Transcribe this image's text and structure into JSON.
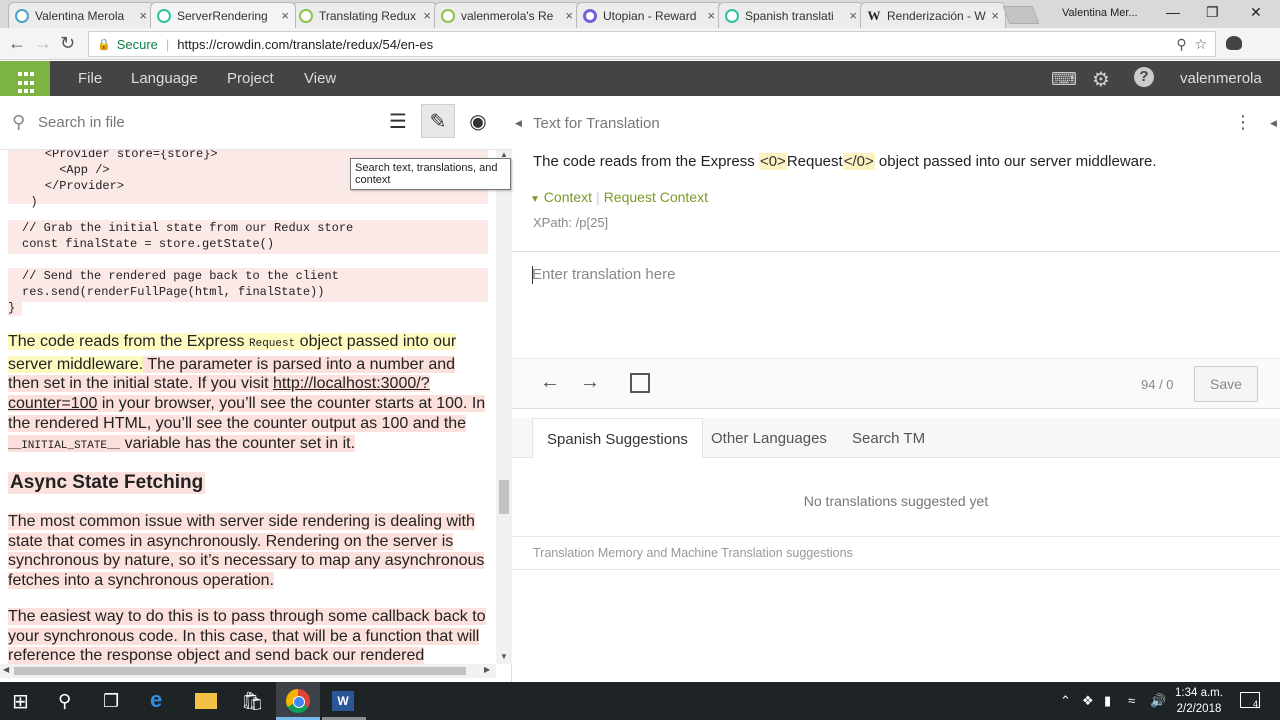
{
  "browser": {
    "tabs": [
      {
        "label": "Valentina Merola",
        "favicon": "steemit-icon"
      },
      {
        "label": "ServerRendering",
        "favicon": "crowdin-icon",
        "active": true
      },
      {
        "label": "Translating Redux",
        "favicon": "crowdin-icon"
      },
      {
        "label": "valenmerola's Re",
        "favicon": "crowdin-icon"
      },
      {
        "label": "Utopian - Reward",
        "favicon": "utopian-icon"
      },
      {
        "label": "Spanish translati",
        "favicon": "crowdin-icon"
      },
      {
        "label": "Renderización - W",
        "favicon": "wikipedia-icon"
      }
    ],
    "tab_close_glyph": "×",
    "profile_name": "Valentina Mer...",
    "secure_label": "Secure",
    "url": "https://crowdin.com/translate/redux/54/en-es"
  },
  "appbar": {
    "menu": [
      "File",
      "Language",
      "Project",
      "View"
    ],
    "username": "valenmerola"
  },
  "source_pane": {
    "search_placeholder": "Search in file",
    "tooltip": "Search text, translations, and context",
    "code_top": "    <Provider store={store}>\n      <App />\n    </Provider>\n  )",
    "code_block_1": "// Grab the initial state from our Redux store\nconst finalState = store.getState()",
    "code_block_2": "// Send the rendered page back to the client\nres.send(renderFullPage(html, finalState))",
    "code_close": "}",
    "para1": {
      "hl_1": "The code reads from the Express ",
      "hl_code": "Request",
      "hl_2": " object passed into our server middleware.",
      "rest_1": " The parameter is parsed into a number and then set in the initial state. If you visit ",
      "link": "http://localhost:3000/?counter=100",
      "rest_2": " in your browser, you’ll see the counter starts at 100. In the rendered HTML, you’ll see the counter output as 100 and the ",
      "code": "__INITIAL_STATE__",
      "rest_3": " variable has the counter set in it."
    },
    "heading": "Async State Fetching",
    "para2": "The most common issue with server side rendering is dealing with state that comes in asynchronously. Rendering on the server is synchronous by nature, so it’s necessary to map any asynchronous fetches into a synchronous operation.",
    "para3": "The easiest way to do this is to pass through some callback back to your synchronous code. In this case, that will be a function that will reference the response object and send back our rendered"
  },
  "translation_pane": {
    "title": "Text for Translation",
    "source": {
      "part1": "The code reads from the Express ",
      "tag_open": "<0>",
      "word": "Request",
      "tag_close": "</0>",
      "part2": " object passed into our server middleware."
    },
    "context_label": "Context",
    "context_value": "Request Context",
    "xpath": "XPath: /p[25]",
    "input_placeholder": "Enter translation here",
    "counter": "94 / 0",
    "save_label": "Save",
    "suggestion_tabs": [
      "Spanish Suggestions",
      "Other Languages",
      "Search TM"
    ],
    "no_suggestions": "No translations suggested yet",
    "tm_label": "Translation Memory and Machine Translation suggestions"
  },
  "taskbar": {
    "time": "1:34 a.m.",
    "date": "2/2/2018",
    "notification_count": "4"
  },
  "colors": {
    "accent_green": "#7cb342",
    "appbar_dark": "#444444",
    "context_green": "#7b9b26",
    "highlight_yellow": "#fdfbc0",
    "highlight_pink": "#fbe0dc"
  }
}
